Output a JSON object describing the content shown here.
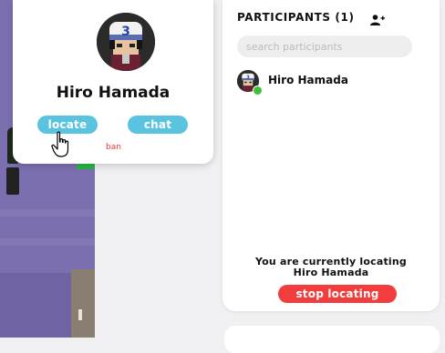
{
  "profile": {
    "name": "Hiro Hamada",
    "avatar_icon": "hiro-avatar-icon",
    "locate_label": "locate",
    "chat_label": "chat",
    "ban_label": "ban"
  },
  "participants": {
    "title": "PARTICIPANTS (1)",
    "add_icon": "add-user-icon",
    "search_placeholder": "search participants",
    "search_value": "",
    "list": [
      {
        "name": "Hiro Hamada",
        "status": "online"
      }
    ],
    "locating_line1": "You are currently locating",
    "locating_line2": "Hiro Hamada",
    "stop_label": "stop locating"
  },
  "colors": {
    "accent_blue": "#5ac3e0",
    "danger_red": "#f13d3d",
    "online_green": "#3cc13b",
    "map_purple": "#7c6fb0"
  }
}
